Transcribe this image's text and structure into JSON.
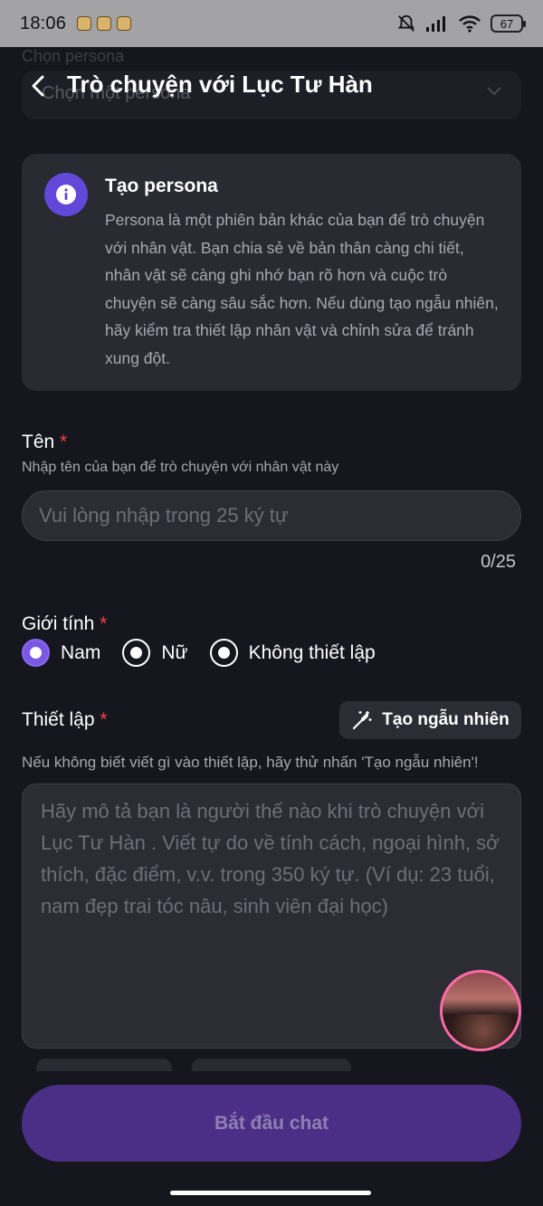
{
  "status_bar": {
    "time": "18:06",
    "battery": "67"
  },
  "header": {
    "ghost_label": "Chọn persona",
    "ghost_select": "Chọn một persona",
    "title": "Trò chuyện với Lục Tư Hàn"
  },
  "info_card": {
    "title": "Tạo persona",
    "body": "Persona là một phiên bản khác của bạn để trò chuyện với nhân vật. Bạn chia sẻ về bản thân càng chi tiết, nhân vật sẽ càng ghi nhớ bạn rõ hơn và cuộc trò chuyện sẽ càng sâu sắc hơn. Nếu dùng tạo ngẫu nhiên, hãy kiểm tra thiết lập nhân vật và chỉnh sửa để tránh xung đột."
  },
  "name_field": {
    "label": "Tên",
    "required_mark": "*",
    "hint": "Nhập tên của bạn để trò chuyện với nhân vật này",
    "placeholder": "Vui lòng nhập trong 25 ký tự",
    "value": "",
    "counter": "0/25"
  },
  "gender": {
    "label": "Giới tính",
    "required_mark": "*",
    "options": [
      {
        "label": "Nam",
        "selected": true
      },
      {
        "label": "Nữ",
        "selected": false
      },
      {
        "label": "Không thiết lập",
        "selected": false
      }
    ]
  },
  "setup": {
    "label": "Thiết lập",
    "required_mark": "*",
    "random_button": "Tạo ngẫu nhiên",
    "hint": "Nếu không biết viết gì vào thiết lập, hãy thử nhấn 'Tạo ngẫu nhiên'!",
    "placeholder": "Hãy mô tả bạn là người thế nào khi trò chuyện với Lục Tư Hàn . Viết tự do về tính cách, ngoại hình, sở thích, đặc điểm, v.v. trong 350 ký tự. (Ví dụ: 23 tuổi, nam đẹp trai tóc nâu, sinh viên đại học)"
  },
  "start_button": "Bắt đầu chat",
  "colors": {
    "background": "#16161f",
    "card": "#2a2a33",
    "accent": "#6248d8",
    "required": "#ee4444",
    "start_button": "#4b2f86"
  },
  "icons": {
    "back": "chevron-left-icon",
    "info": "info-icon",
    "random": "magic-wand-icon"
  }
}
